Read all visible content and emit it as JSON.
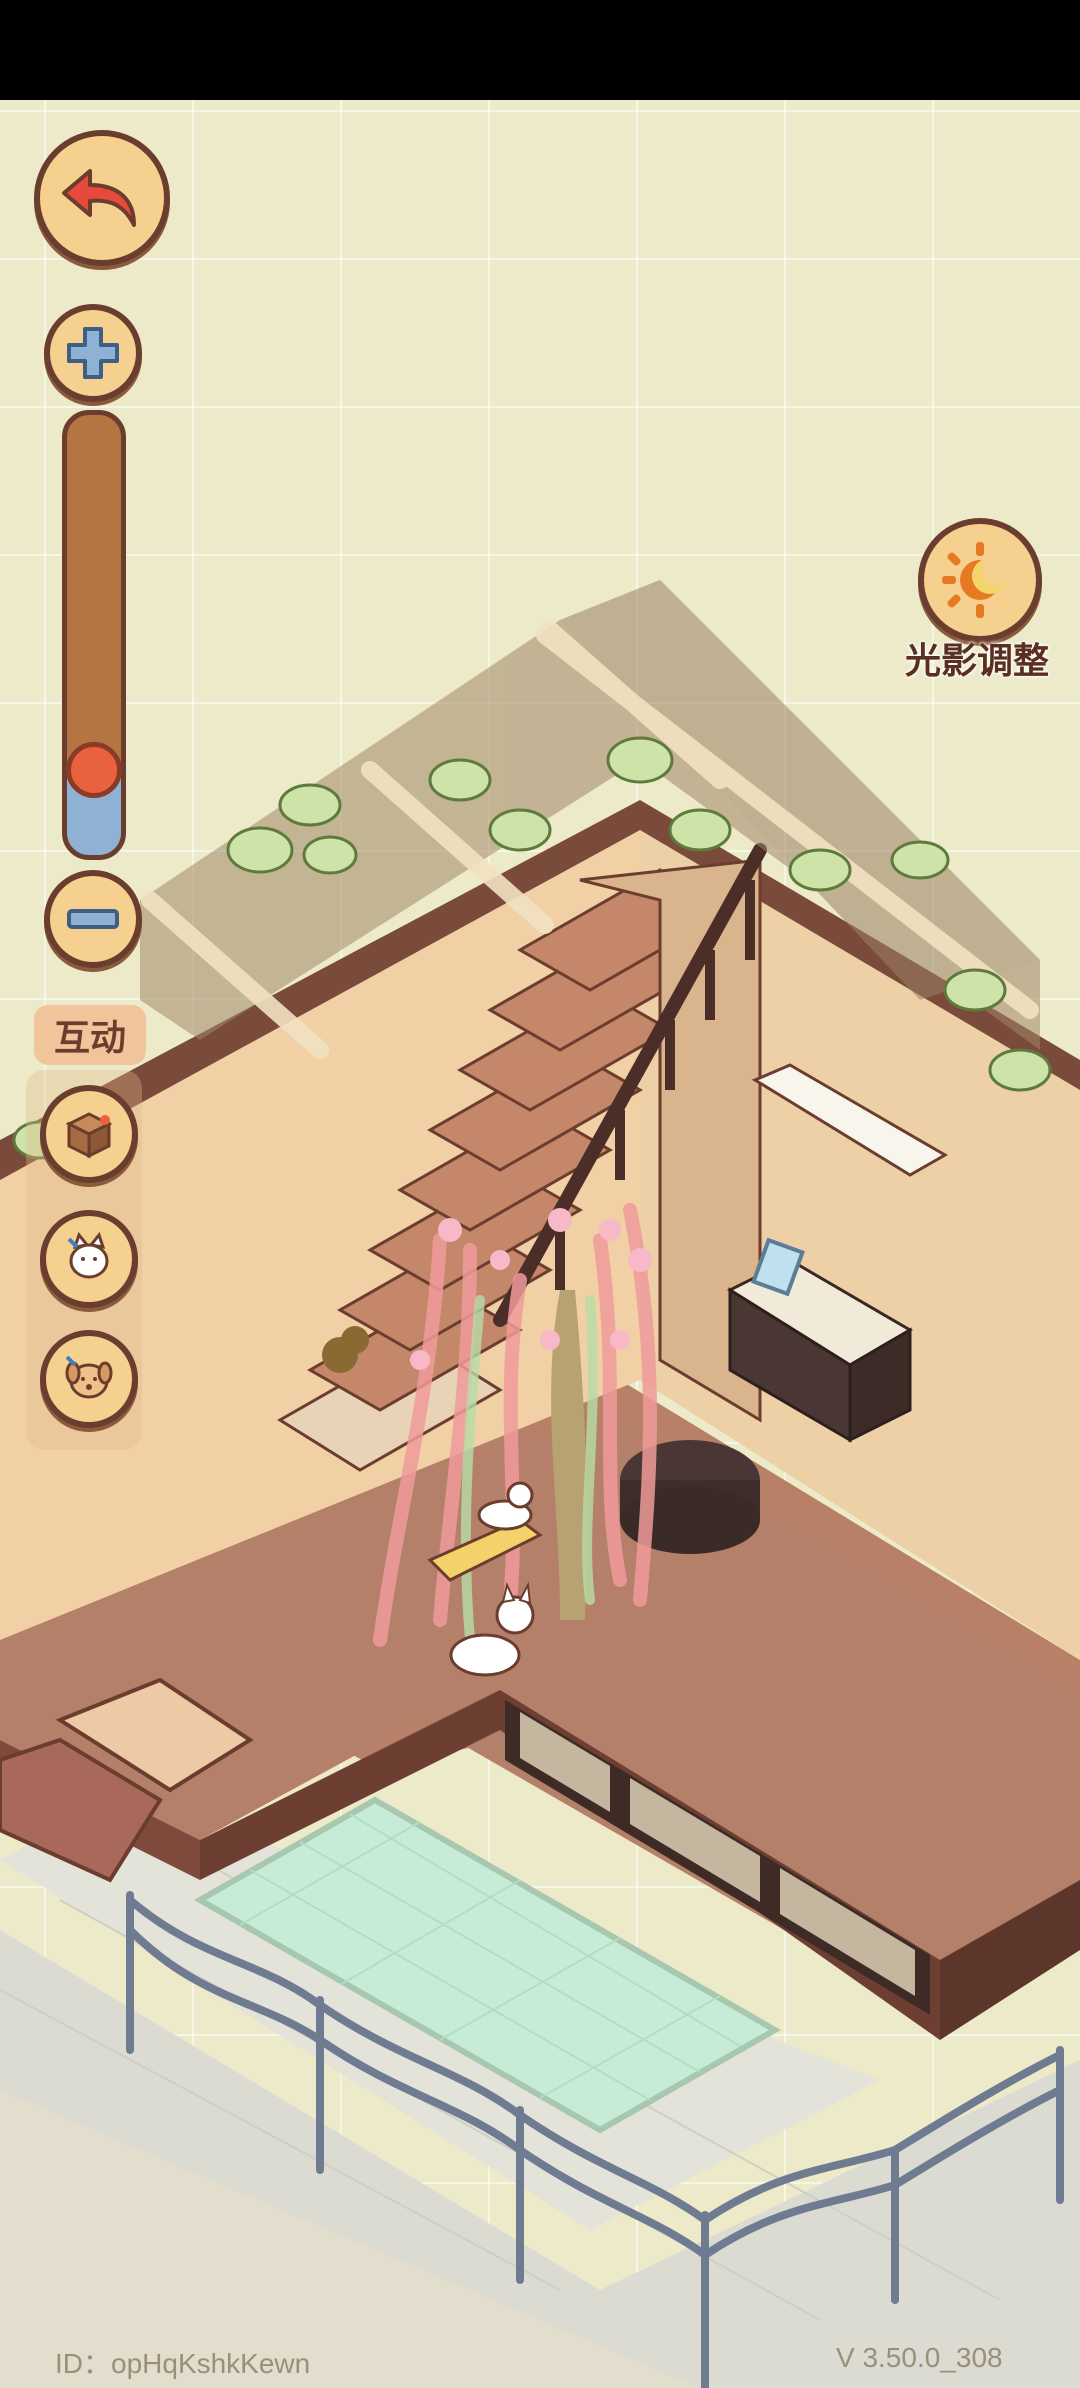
{
  "ui": {
    "interact_label": "互动",
    "light_label": "光影调整",
    "zoom_level": 0.2
  },
  "footer": {
    "player_id": "ID：opHqKshkKewn",
    "version": "V 3.50.0_308"
  },
  "icons": {
    "back": "undo-arrow-icon",
    "zoom_in": "plus-icon",
    "zoom_out": "minus-icon",
    "box": "box-icon",
    "cat": "cat-icon",
    "dog": "dog-icon",
    "light": "sun-moon-icon"
  }
}
